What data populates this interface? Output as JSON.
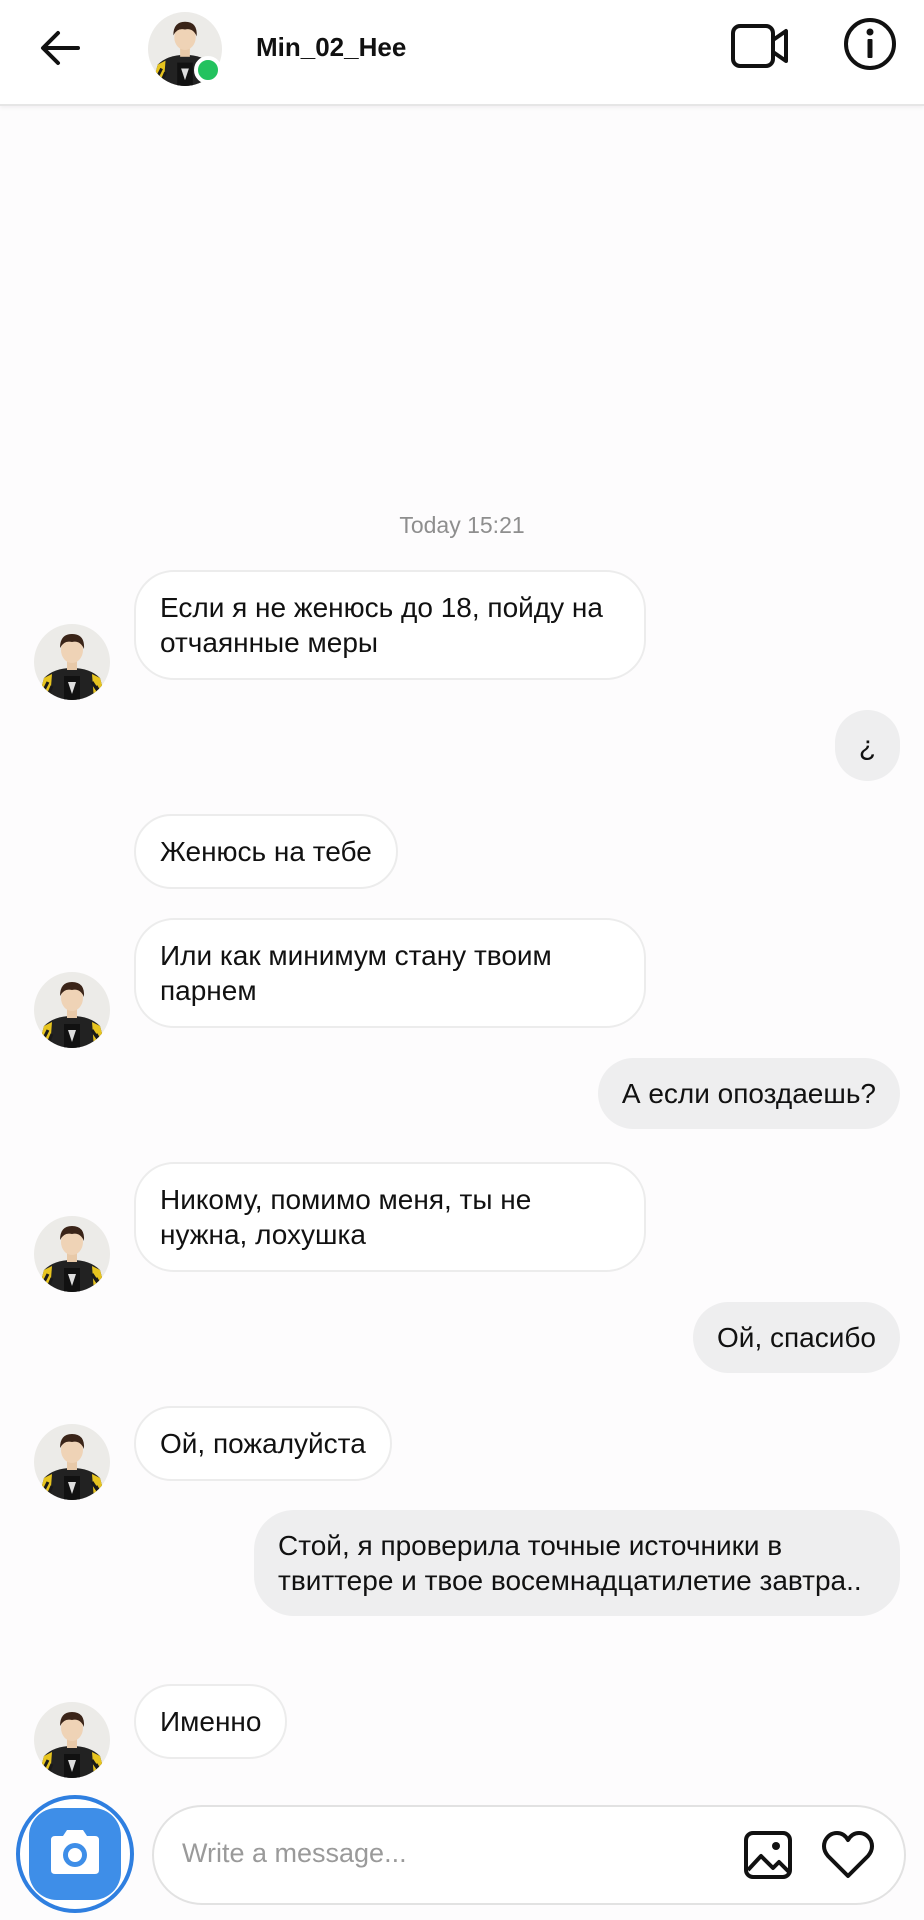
{
  "header": {
    "username": "Min_02_Hee",
    "online": true,
    "online_color": "#23c25e",
    "icons": [
      "back-arrow-icon",
      "video-call-icon",
      "info-icon"
    ]
  },
  "chat": {
    "timestamp": "Today 15:21",
    "messages": [
      {
        "from": "them",
        "text": "Если я не женюсь до 18, пойду на отчаянные меры"
      },
      {
        "from": "me",
        "text": "¿"
      },
      {
        "from": "them",
        "text": "Женюсь на тебе"
      },
      {
        "from": "them",
        "text": "Или как минимум стану твоим парнем"
      },
      {
        "from": "me",
        "text": "А если опоздаешь?"
      },
      {
        "from": "them",
        "text": "Никому, помимо меня, ты не нужна, лохушка"
      },
      {
        "from": "me",
        "text": "Ой, спасибо"
      },
      {
        "from": "them",
        "text": "Ой, пожалуйста"
      },
      {
        "from": "me",
        "text": "Стой, я проверила точные источники в твиттере и твое восемнадцатилетие завтра.."
      },
      {
        "from": "them",
        "text": "Именно"
      }
    ]
  },
  "composer": {
    "placeholder": "Write a message...",
    "accent_color": "#2f7fe0",
    "icons": [
      "camera-icon",
      "gallery-icon",
      "heart-icon"
    ]
  },
  "colors": {
    "incoming_bubble": "#ffffff",
    "outgoing_bubble": "#eeeeef",
    "timestamp": "#8e8e8e"
  }
}
